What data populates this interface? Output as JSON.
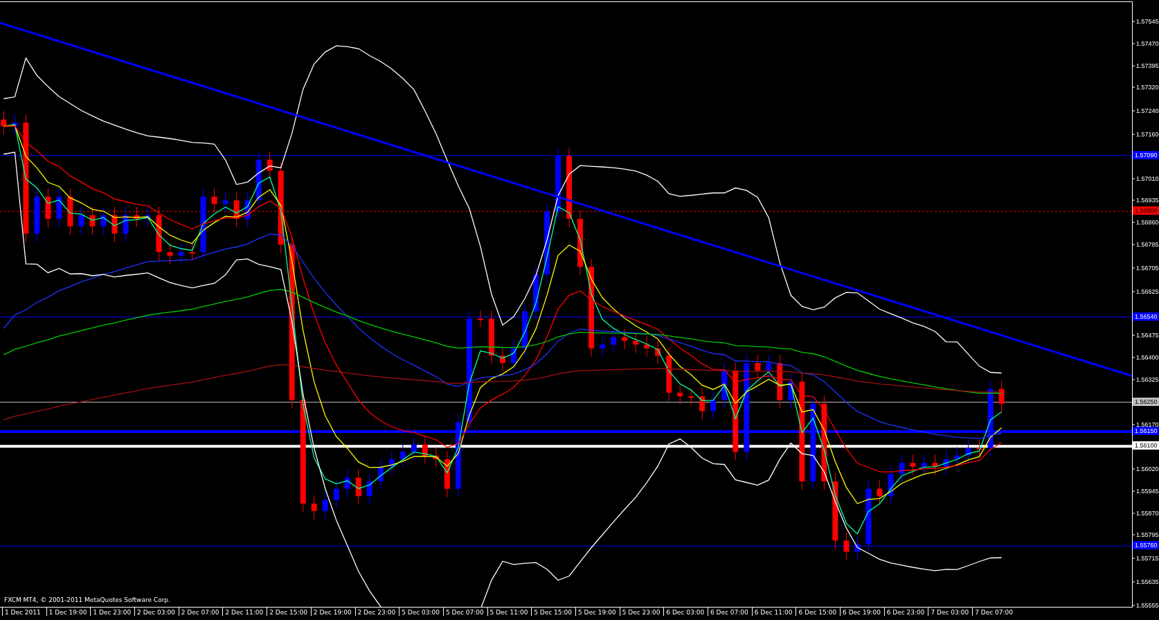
{
  "chart": {
    "copyright": "FXCM MT4, © 2001-2011 MetaQuotes Software Corp.",
    "price_axis": [
      "1.57545",
      "1.57470",
      "1.57395",
      "1.57320",
      "1.57240",
      "1.57160",
      "1.57010",
      "1.56935",
      "1.56860",
      "1.56785",
      "1.56705",
      "1.56625",
      "1.56475",
      "1.56400",
      "1.56325",
      "1.56170",
      "1.56020",
      "1.55945",
      "1.55870",
      "1.55795",
      "1.55715",
      "1.55635",
      "1.55555"
    ],
    "time_axis": [
      "1 Dec 2011",
      "1 Dec 19:00",
      "1 Dec 23:00",
      "2 Dec 03:00",
      "2 Dec 07:00",
      "2 Dec 11:00",
      "2 Dec 15:00",
      "2 Dec 19:00",
      "2 Dec 23:00",
      "5 Dec 03:00",
      "5 Dec 07:00",
      "5 Dec 11:00",
      "5 Dec 15:00",
      "5 Dec 19:00",
      "5 Dec 23:00",
      "6 Dec 03:00",
      "6 Dec 07:00",
      "6 Dec 11:00",
      "6 Dec 15:00",
      "6 Dec 19:00",
      "6 Dec 23:00",
      "7 Dec 03:00",
      "7 Dec 07:00"
    ],
    "levels": [
      {
        "label": "1.57090",
        "color": "#0000ff",
        "kind": "thin"
      },
      {
        "label": "1.56900",
        "color": "#ff0000",
        "kind": "dashed"
      },
      {
        "label": "1.56540",
        "color": "#0000ff",
        "kind": "thin"
      },
      {
        "label": "1.56250",
        "color": "#c0c0c0",
        "kind": "thin"
      },
      {
        "label": "1.56150",
        "color": "#0000ff",
        "kind": "thick"
      },
      {
        "label": "1.56100",
        "color": "#ffffff",
        "kind": "thick"
      },
      {
        "label": "1.55760",
        "color": "#0000ff",
        "kind": "thin"
      }
    ]
  }
}
